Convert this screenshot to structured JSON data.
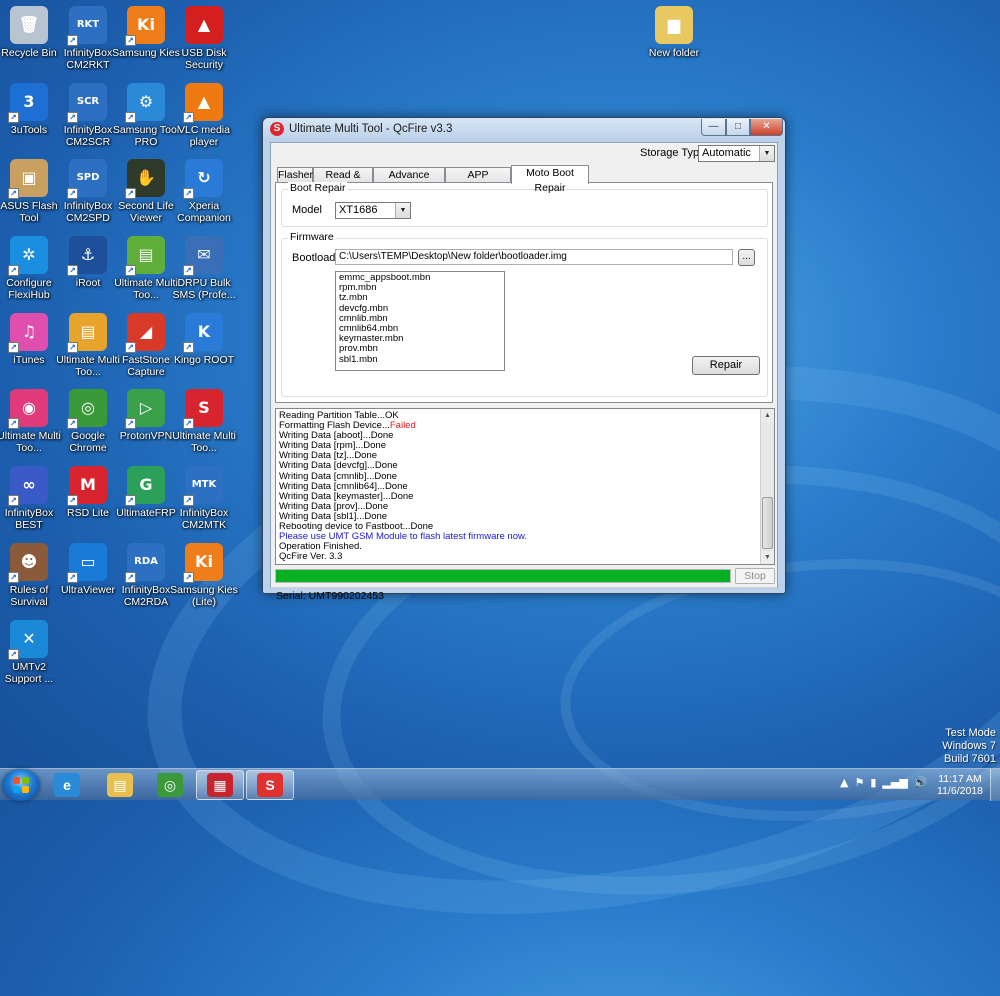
{
  "desktop": {
    "icons": [
      {
        "label": "Recycle Bin",
        "icon": "recycle-bin-icon",
        "color": "#b8c4cf",
        "glyph": "🗑"
      },
      {
        "label": "InfinityBox CM2RKT",
        "icon": "infinitybox-rkt-icon",
        "color": "#2d6fc0",
        "glyph": "RKT"
      },
      {
        "label": "Samsung Kies",
        "icon": "samsung-kies-icon",
        "color": "#ef7d1a",
        "glyph": "Ki"
      },
      {
        "label": "USB Disk Security",
        "icon": "usb-disk-security-icon",
        "color": "#d41f1f",
        "glyph": "▲"
      },
      {
        "label": "3uTools",
        "icon": "3utools-icon",
        "color": "#1e6fd4",
        "glyph": "3"
      },
      {
        "label": "InfinityBox CM2SCR",
        "icon": "infinitybox-scr-icon",
        "color": "#2d6fc0",
        "glyph": "SCR"
      },
      {
        "label": "Samsung Tool PRO",
        "icon": "samsung-tool-pro-icon",
        "color": "#2a8ad8",
        "glyph": "⚙"
      },
      {
        "label": "VLC media player",
        "icon": "vlc-icon",
        "color": "#f07a12",
        "glyph": "▲"
      },
      {
        "label": "ASUS Flash Tool",
        "icon": "asus-flash-tool-icon",
        "color": "#c9a060",
        "glyph": "▣"
      },
      {
        "label": "InfinityBox CM2SPD",
        "icon": "infinitybox-spd-icon",
        "color": "#2d6fc0",
        "glyph": "SPD"
      },
      {
        "label": "Second Life Viewer",
        "icon": "second-life-icon",
        "color": "#2f3b2a",
        "glyph": "✋"
      },
      {
        "label": "Xperia Companion",
        "icon": "xperia-companion-icon",
        "color": "#2a7ad8",
        "glyph": "↻"
      },
      {
        "label": "Configure FlexiHub",
        "icon": "flexihub-icon",
        "color": "#1a8fe0",
        "glyph": "✲"
      },
      {
        "label": "iRoot",
        "icon": "iroot-icon",
        "color": "#1d4f9a",
        "glyph": "⚓"
      },
      {
        "label": "Ultimate Multi Too...",
        "icon": "ultimate-multi-tool-icon",
        "color": "#5fae3a",
        "glyph": "▤"
      },
      {
        "label": "DRPU Bulk SMS (Profe...",
        "icon": "drpu-bulk-sms-icon",
        "color": "#3a6fb8",
        "glyph": "✉"
      },
      {
        "label": "iTunes",
        "icon": "itunes-icon",
        "color": "#e04fae",
        "glyph": "♫"
      },
      {
        "label": "Ultimate Multi Too...",
        "icon": "ultimate-multi-tool-icon",
        "color": "#e8a32a",
        "glyph": "▤"
      },
      {
        "label": "FastStone Capture",
        "icon": "faststone-capture-icon",
        "color": "#d83a2a",
        "glyph": "◢"
      },
      {
        "label": "Kingo ROOT",
        "icon": "kingo-root-icon",
        "color": "#2a7ad8",
        "glyph": "K"
      },
      {
        "label": "Ultimate Multi Too...",
        "icon": "ultimate-multi-tool-icon",
        "color": "#e03a7a",
        "glyph": "◉"
      },
      {
        "label": "Google Chrome",
        "icon": "chrome-icon",
        "color": "#3a9a3a",
        "glyph": "◎"
      },
      {
        "label": "ProtonVPN",
        "icon": "protonvpn-icon",
        "color": "#3aa04a",
        "glyph": "▷"
      },
      {
        "label": "Ultimate Multi Too...",
        "icon": "ultimate-multi-tool-icon",
        "color": "#d8242e",
        "glyph": "S"
      },
      {
        "label": "InfinityBox BEST",
        "icon": "infinitybox-best-icon",
        "color": "#3a5ac8",
        "glyph": "∞"
      },
      {
        "label": "RSD Lite",
        "icon": "rsd-lite-icon",
        "color": "#d8242e",
        "glyph": "M"
      },
      {
        "label": "UltimateFRP",
        "icon": "ultimatefrp-icon",
        "color": "#2aa05a",
        "glyph": "G"
      },
      {
        "label": "InfinityBox CM2MTK",
        "icon": "infinitybox-mtk-icon",
        "color": "#2d6fc0",
        "glyph": "MTK"
      },
      {
        "label": "Rules of Survival",
        "icon": "rules-of-survival-icon",
        "color": "#8a5a3a",
        "glyph": "☻"
      },
      {
        "label": "UltraViewer",
        "icon": "ultraviewer-icon",
        "color": "#1a7ad8",
        "glyph": "▭"
      },
      {
        "label": "InfinityBox CM2RDA",
        "icon": "infinitybox-rda-icon",
        "color": "#2d6fc0",
        "glyph": "RDA"
      },
      {
        "label": "Samsung Kies (Lite)",
        "icon": "samsung-kies-lite-icon",
        "color": "#ef7d1a",
        "glyph": "Ki"
      },
      {
        "label": "UMTv2 Support ...",
        "icon": "umtv2-support-icon",
        "color": "#1a8ad8",
        "glyph": "✕"
      },
      {
        "label": "New folder",
        "icon": "folder-icon",
        "color": "#e8c860",
        "glyph": "▆"
      }
    ]
  },
  "window": {
    "title": "Ultimate Multi Tool - QcFire v3.3",
    "min_glyph": "—",
    "max_glyph": "□",
    "close_glyph": "✕",
    "storage_label": "Storage Type",
    "storage_value": "Automatic",
    "tabs": [
      "Flasher",
      "Read & Tools",
      "Advance Flasher",
      "APP Converter",
      "Moto Boot Repair"
    ],
    "active_tab": "Moto Boot Repair",
    "boot_repair": {
      "group_title": "Boot Repair",
      "model_label": "Model",
      "model_value": "XT1686"
    },
    "firmware": {
      "group_title": "Firmware",
      "bootloader_label": "Bootloader",
      "bootloader_path": "C:\\Users\\TEMP\\Desktop\\New folder\\bootloader.img",
      "browse_label": "...",
      "files": [
        "emmc_appsboot.mbn",
        "rpm.mbn",
        "tz.mbn",
        "devcfg.mbn",
        "cmnlib.mbn",
        "cmnlib64.mbn",
        "keymaster.mbn",
        "prov.mbn",
        "sbl1.mbn"
      ],
      "repair_label": "Repair"
    },
    "log": [
      {
        "text": "Reading Partition Table...OK"
      },
      {
        "text": "Formatting Flash Device...",
        "error": "Failed"
      },
      {
        "text": "Writing Data [aboot]...Done"
      },
      {
        "text": "Writing Data [rpm]...Done"
      },
      {
        "text": "Writing Data [tz]...Done"
      },
      {
        "text": "Writing Data [devcfg]...Done"
      },
      {
        "text": "Writing Data [cmnlib]...Done"
      },
      {
        "text": "Writing Data [cmnlib64]...Done"
      },
      {
        "text": "Writing Data [keymaster]...Done"
      },
      {
        "text": "Writing Data [prov]...Done"
      },
      {
        "text": "Writing Data [sbl1]...Done"
      },
      {
        "text": "Rebooting device to Fastboot...Done"
      },
      {
        "text": "Please use UMT GSM Module to flash latest firmware now.",
        "info": true
      },
      {
        "text": "Operation Finished."
      },
      {
        "text": "QcFire Ver. 3.3"
      }
    ],
    "progress_percent": 100,
    "stop_label": "Stop",
    "serial": "Serial: UMT990202453"
  },
  "watermark": {
    "line1": "Test Mode",
    "line2": "Windows 7",
    "line3": "Build 7601"
  },
  "taskbar": {
    "apps": [
      {
        "icon": "internet-explorer-icon",
        "color": "#2a8ad8",
        "glyph": "e",
        "active": false
      },
      {
        "icon": "file-explorer-icon",
        "color": "#e8c050",
        "glyph": "▤",
        "active": false
      },
      {
        "icon": "chrome-icon",
        "color": "#3a9a3a",
        "glyph": "◎",
        "active": false
      },
      {
        "icon": "toolbox-icon",
        "color": "#c8242e",
        "glyph": "▦",
        "active": true
      },
      {
        "icon": "qcfire-icon",
        "color": "#e03030",
        "glyph": "S",
        "active": true
      }
    ],
    "tray_icons": [
      "▲",
      "⚑",
      "▮",
      "▂▄▆",
      "🔊"
    ],
    "time": "11:17 AM",
    "date": "11/6/2018"
  },
  "colors": {
    "error": "#e01919",
    "info": "#1a1ad0",
    "progress": "#06b025"
  }
}
